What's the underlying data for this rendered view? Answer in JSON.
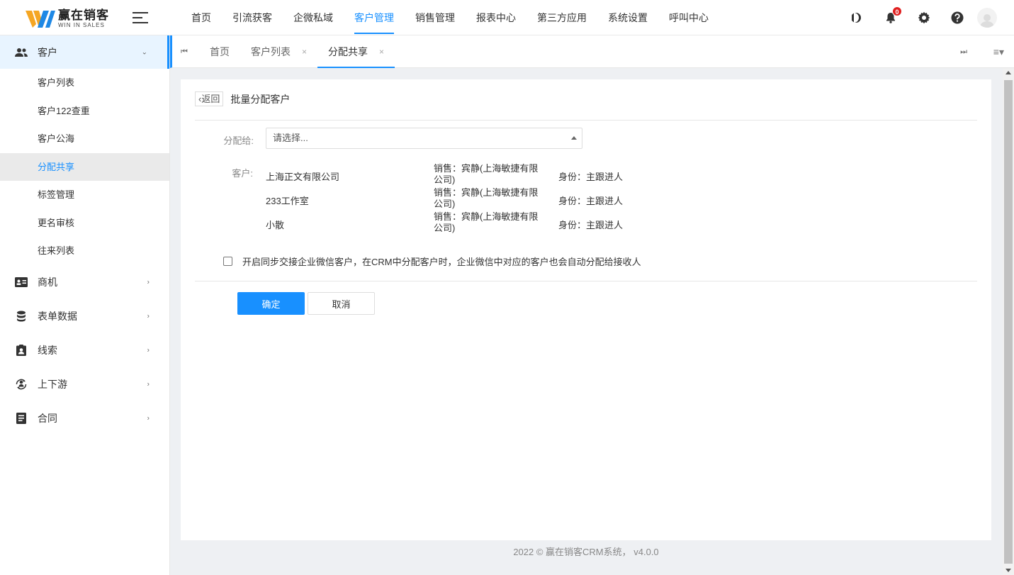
{
  "brand": {
    "name_cn": "赢在销客",
    "name_en": "WIN IN SALES",
    "accent": "#1890ff"
  },
  "topnav": {
    "items": [
      "首页",
      "引流获客",
      "企微私域",
      "客户管理",
      "销售管理",
      "报表中心",
      "第三方应用",
      "系统设置",
      "呼叫中心"
    ],
    "active": "客户管理"
  },
  "header_icons": {
    "theme": "moon-icon",
    "notifications": "bell-icon",
    "notification_count": "0",
    "settings": "gear-icon",
    "help": "help-icon",
    "avatar": "user-avatar"
  },
  "sidebar": {
    "customer_group": {
      "label": "客户",
      "items": [
        "客户列表",
        "客户122查重",
        "客户公海",
        "分配共享",
        "标签管理",
        "更名审核",
        "往来列表"
      ],
      "active": "分配共享"
    },
    "groups": [
      "商机",
      "表单数据",
      "线索",
      "上下游",
      "合同"
    ]
  },
  "tabs": {
    "items": [
      {
        "label": "首页",
        "closable": false
      },
      {
        "label": "客户列表",
        "closable": true
      },
      {
        "label": "分配共享",
        "closable": true
      }
    ],
    "active": "分配共享"
  },
  "page": {
    "back_label": "返回",
    "title": "批量分配客户",
    "assign_label": "分配给:",
    "select_placeholder": "请选择...",
    "customer_label": "客户:",
    "customers": [
      {
        "name": "上海正文有限公司",
        "sales": "销售：宾静(上海敏捷有限公司)",
        "role": "身份：主跟进人"
      },
      {
        "name": "233工作室",
        "sales": "销售：宾静(上海敏捷有限公司)",
        "role": "身份：主跟进人"
      },
      {
        "name": "小散",
        "sales": "销售：宾静(上海敏捷有限公司)",
        "role": "身份：主跟进人"
      }
    ],
    "sync_checked": false,
    "sync_text": "开启同步交接企业微信客户，在CRM中分配客户时，企业微信中对应的客户也会自动分配给接收人",
    "confirm_label": "确定",
    "cancel_label": "取消"
  },
  "footer": "2022 © 赢在销客CRM系统， v4.0.0"
}
